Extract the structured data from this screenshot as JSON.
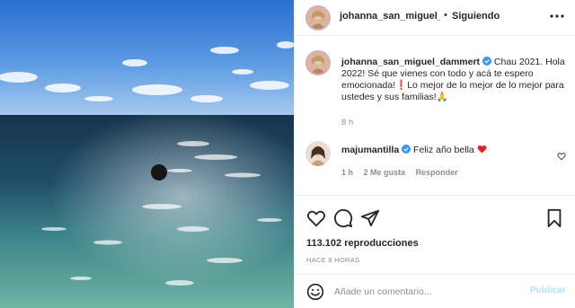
{
  "post": {
    "username": "johanna_san_miguel_dammert",
    "username_truncated": "johanna_san_miguel_c",
    "follow_label": "Siguiendo",
    "dot": "•",
    "caption_text_1": "Chau 2021. Hola 2022! Sé que vienes con todo y acá te espero emocionada!",
    "caption_text_2": "Lo mejor de lo mejor de lo mejor para ustedes y sus familias!",
    "caption_time": "8 h",
    "views": "113.102 reproducciones",
    "posted_ago": "HACE 8 HORAS"
  },
  "comment": {
    "username": "majumantilla",
    "text": "Feliz año bella",
    "time": "1 h",
    "likes": "2 Me gusta",
    "reply_label": "Responder"
  },
  "add_comment": {
    "placeholder": "Añade un comentario...",
    "publish_label": "Publicar"
  },
  "colors": {
    "accent_blue": "#0095f6",
    "publish_disabled": "#b2dffc",
    "secondary_text": "#8e8e8e",
    "heart_red": "#ed4956"
  },
  "icons": [
    "more-options-icon",
    "verified-badge-icon",
    "like-icon",
    "comment-icon",
    "share-icon",
    "save-icon",
    "emoji-icon",
    "red-heart-emoji",
    "red-exclamation-emoji",
    "praying-hands-emoji"
  ]
}
